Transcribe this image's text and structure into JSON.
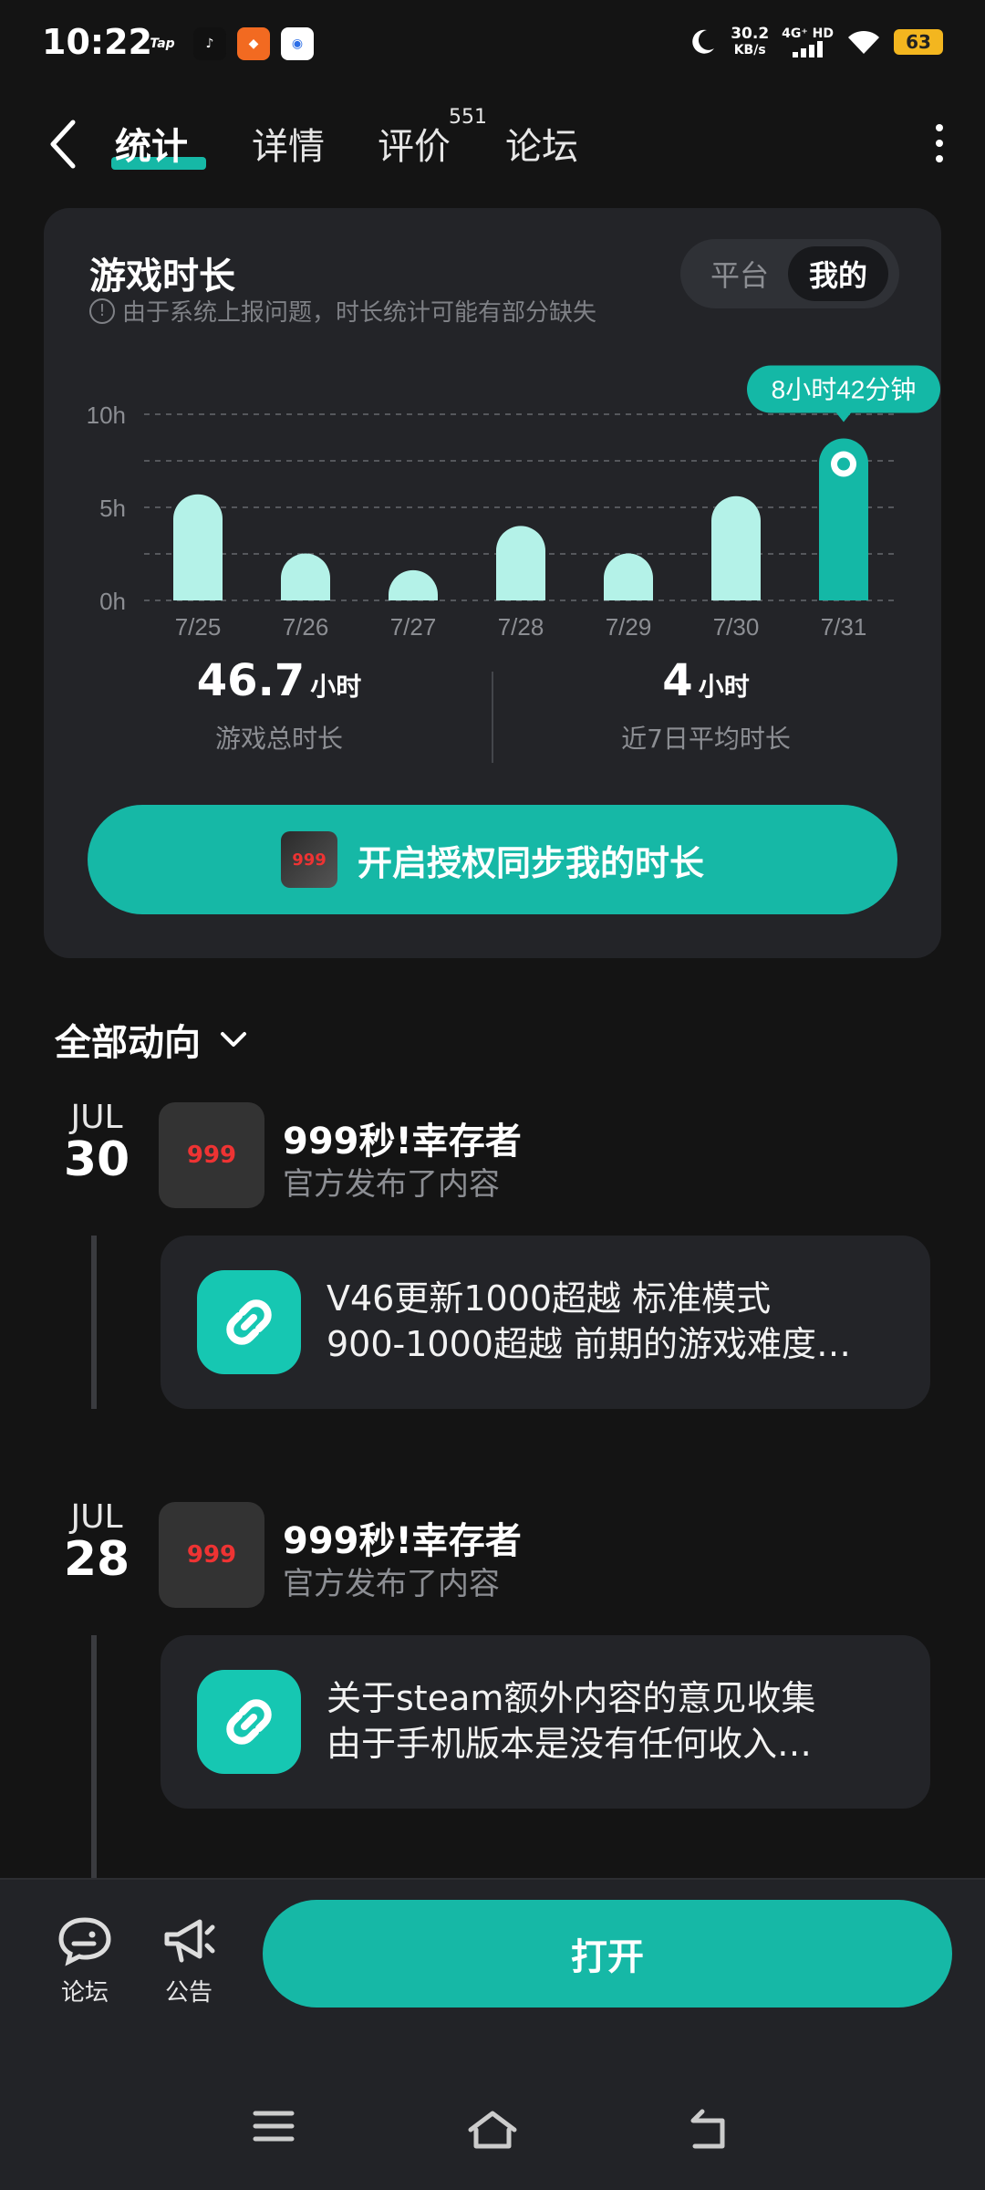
{
  "status_bar": {
    "time": "10:22",
    "app_icons": [
      "Tap",
      "♪",
      "◆",
      "◉"
    ],
    "net_speed": "30.2",
    "net_unit": "KB/s",
    "signal": "4G⁺ HD",
    "battery": "63"
  },
  "nav": {
    "tabs": [
      "统计",
      "详情",
      "评价",
      "论坛"
    ],
    "review_count": "551"
  },
  "stats": {
    "title": "游戏时长",
    "note": "由于系统上报问题，时长统计可能有部分缺失",
    "toggle": [
      "平台",
      "我的"
    ],
    "total_value": "46.7",
    "total_unit": "小时",
    "total_label": "游戏总时长",
    "avg_value": "4",
    "avg_unit": "小时",
    "avg_label": "近7日平均时长",
    "sync_button": "开启授权同步我的时长"
  },
  "chart_data": {
    "type": "bar",
    "categories": [
      "7/25",
      "7/26",
      "7/27",
      "7/28",
      "7/29",
      "7/30",
      "7/31"
    ],
    "values": [
      5.7,
      2.4,
      0.6,
      4.0,
      2.4,
      5.6,
      8.7
    ],
    "y_ticks": [
      "10h",
      "5h",
      "0h"
    ],
    "ylim": [
      0,
      10
    ],
    "highlight_index": 6,
    "highlight_label": "8小时42分钟",
    "grid": true,
    "colors": {
      "bar": "#b4f2e8",
      "highlight": "#14b8a6"
    }
  },
  "feed": {
    "filter_label": "全部动向",
    "posts": [
      {
        "month": "JUL",
        "day": "30",
        "game": "999秒!幸存者",
        "subtitle": "官方发布了内容",
        "line1": "V46更新1000超越 标准模式",
        "line2": "900-1000超越 前期的游戏难度…"
      },
      {
        "month": "JUL",
        "day": "28",
        "game": "999秒!幸存者",
        "subtitle": "官方发布了内容",
        "line1": "关于steam额外内容的意见收集",
        "line2": "由于手机版本是没有任何收入…"
      }
    ]
  },
  "bottom": {
    "forum_label": "论坛",
    "notice_label": "公告",
    "open_button": "打开"
  },
  "colors": {
    "accent": "#16b8a6",
    "background": "#141414",
    "card": "#232428"
  }
}
